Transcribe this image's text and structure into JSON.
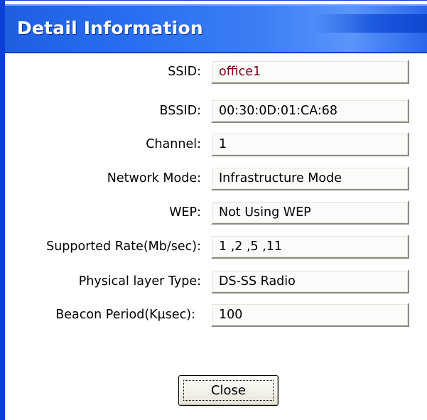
{
  "window": {
    "title": "Detail Information"
  },
  "fields": [
    {
      "label": "SSID:",
      "value": "office1"
    },
    {
      "label": "BSSID:",
      "value": "00:30:0D:01:CA:68"
    },
    {
      "label": "Channel:",
      "value": "1"
    },
    {
      "label": "Network Mode:",
      "value": "Infrastructure Mode"
    },
    {
      "label": "WEP:",
      "value": "Not Using WEP"
    },
    {
      "label": "Supported Rate(Mb/sec):",
      "value": "1 ,2 ,5 ,11"
    },
    {
      "label": "Physical layer Type:",
      "value": "DS-SS Radio"
    },
    {
      "label": "Beacon Period(Kµsec):",
      "value": "100"
    }
  ],
  "buttons": {
    "close_label": "Close"
  },
  "colors": {
    "titlebar": "#2a6ef0",
    "ssid_text": "#7a0018"
  }
}
